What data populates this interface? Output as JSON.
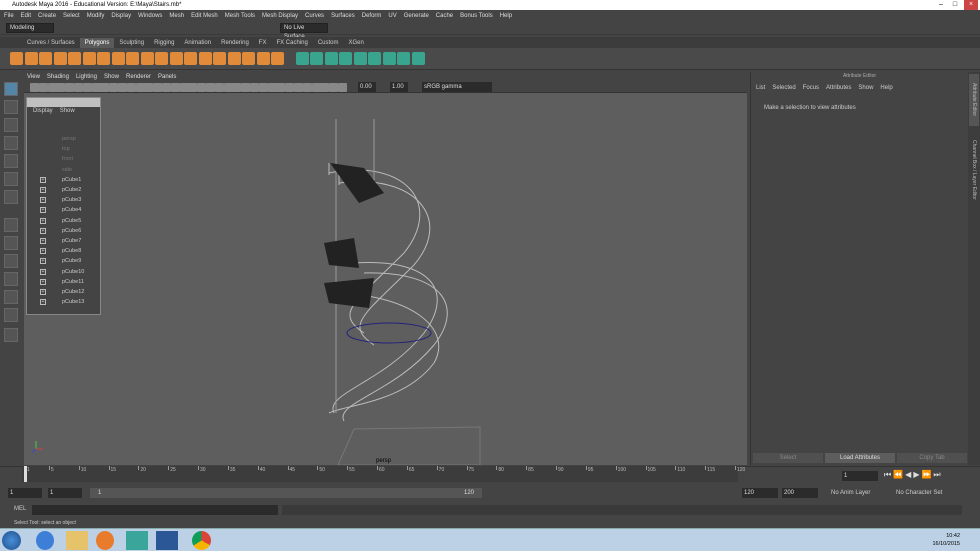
{
  "window": {
    "title": "Autodesk Maya 2016 - Educational Version: E:\\Maya\\Stairs.mb*"
  },
  "menus": [
    "File",
    "Edit",
    "Create",
    "Select",
    "Modify",
    "Display",
    "Windows",
    "Mesh",
    "Edit Mesh",
    "Mesh Tools",
    "Mesh Display",
    "Curves",
    "Surfaces",
    "Deform",
    "UV",
    "Generate",
    "Cache",
    "Bonus Tools",
    "Help"
  ],
  "status": {
    "mode": "Modeling",
    "live_surface": "No Live Surface"
  },
  "shelf_tabs": [
    "Curves / Surfaces",
    "Polygons",
    "Sculpting",
    "Rigging",
    "Animation",
    "Rendering",
    "FX",
    "FX Caching",
    "Custom",
    "XGen"
  ],
  "shelf_active": "Polygons",
  "viewport": {
    "menus": [
      "View",
      "Shading",
      "Lighting",
      "Show",
      "Renderer",
      "Panels"
    ],
    "exposure": "0.00",
    "gamma": "1.00",
    "color_space": "sRGB gamma",
    "camera_label": "persp"
  },
  "outliner": {
    "menus": [
      "Display",
      "Show"
    ],
    "cameras": [
      "persp",
      "top",
      "front",
      "side"
    ],
    "items": [
      "pCube1",
      "pCube2",
      "pCube3",
      "pCube4",
      "pCube5",
      "pCube6",
      "pCube7",
      "pCube8",
      "pCube9",
      "pCube10",
      "pCube11",
      "pCube12",
      "pCube13"
    ]
  },
  "attribute_editor": {
    "title": "Attribute Editor",
    "menus": [
      "List",
      "Selected",
      "Focus",
      "Attributes",
      "Show",
      "Help"
    ],
    "message": "Make a selection to view attributes",
    "buttons": [
      "Select",
      "Load Attributes",
      "Copy Tab"
    ]
  },
  "side_tabs": [
    "Attribute Editor",
    "Channel Box / Layer Editor"
  ],
  "timeline": {
    "ticks": [
      1,
      5,
      10,
      15,
      20,
      25,
      30,
      35,
      40,
      45,
      50,
      55,
      60,
      65,
      70,
      75,
      80,
      85,
      90,
      95,
      100,
      105,
      110,
      115,
      120
    ],
    "current_frame": "1"
  },
  "range": {
    "start": "1",
    "start2": "1",
    "slider_start": "1",
    "slider_end": "120",
    "end": "120",
    "end2": "200",
    "anim_layer": "No Anim Layer",
    "char_set": "No Character Set"
  },
  "command": {
    "label": "MEL"
  },
  "help_line": "Select Tool: select an object",
  "clock": {
    "time": "10:42",
    "date": "16/10/2015"
  },
  "colors": {
    "accent": "#5285a6",
    "shelf_orange": "#e08a3a",
    "shelf_teal": "#3aa58f",
    "viewport": "#5e5e5e"
  }
}
